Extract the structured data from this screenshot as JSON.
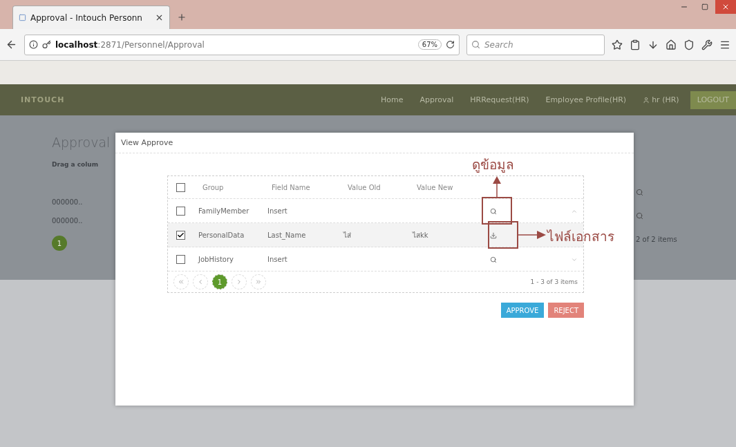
{
  "browser": {
    "tab_title": "Approval - Intouch Personn",
    "url_host": "localhost",
    "url_path": ":2871/Personnel/Approval",
    "zoom": "67%",
    "search_placeholder": "Search"
  },
  "navbar": {
    "logo": "INTOUCH",
    "links": [
      "Home",
      "Approval",
      "HRRequest(HR)",
      "Employee Profile(HR)"
    ],
    "user": "hr (HR)",
    "logout": "LOGOUT"
  },
  "page": {
    "title": "Approval",
    "group_hint": "Drag a colum",
    "rows": [
      "000000..",
      "000000.."
    ],
    "pages": [
      {
        "label": "1",
        "selected": true
      }
    ],
    "pager_summary": "2 of 2 items"
  },
  "modal": {
    "title": "View Approve",
    "header_checked": false,
    "columns": [
      "Group",
      "Field Name",
      "Value Old",
      "Value New"
    ],
    "rows": [
      {
        "group": "FamilyMember",
        "field": "Insert",
        "old": "",
        "new": "",
        "checked": false,
        "kind": "view"
      },
      {
        "group": "PersonalData",
        "field": "Last_Name",
        "old": "ไส่",
        "new": "ไสkk",
        "checked": true,
        "kind": "download"
      },
      {
        "group": "JobHistory",
        "field": "Insert",
        "old": "",
        "new": "",
        "checked": false,
        "kind": "view"
      }
    ],
    "pages": [
      {
        "label": "1",
        "selected": true
      }
    ],
    "summary": "1 - 3 of 3 items",
    "buttons": [
      {
        "label": "APPROVE",
        "kind": "primary"
      },
      {
        "label": "REJECT",
        "kind": "danger"
      }
    ]
  },
  "annotations": [
    {
      "text": "ดูข้อมูล",
      "kind": "up"
    },
    {
      "text": "ไฟล์เอกสาร",
      "kind": "right"
    }
  ]
}
